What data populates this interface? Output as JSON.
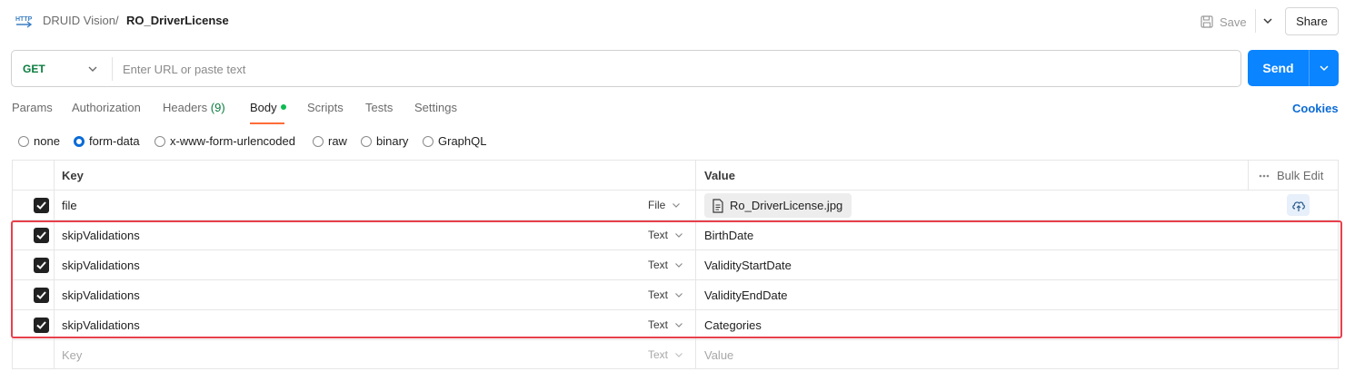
{
  "breadcrumb": {
    "collection": "DRUID Vision",
    "separator": "/",
    "request": "RO_DriverLicense"
  },
  "header": {
    "save_label": "Save",
    "share_label": "Share",
    "icons": [
      "http-icon",
      "save-icon",
      "chevron-down-icon"
    ]
  },
  "request": {
    "method": "GET",
    "url_value": "",
    "url_placeholder": "Enter URL or paste text",
    "send_label": "Send"
  },
  "tabs": [
    {
      "label": "Params"
    },
    {
      "label": "Authorization"
    },
    {
      "label": "Headers",
      "count": "(9)"
    },
    {
      "label": "Body",
      "active": true
    },
    {
      "label": "Scripts"
    },
    {
      "label": "Tests"
    },
    {
      "label": "Settings"
    }
  ],
  "cookies_label": "Cookies",
  "body_modes": [
    {
      "label": "none",
      "selected": false
    },
    {
      "label": "form-data",
      "selected": true
    },
    {
      "label": "x-www-form-urlencoded",
      "selected": false
    },
    {
      "label": "raw",
      "selected": false
    },
    {
      "label": "binary",
      "selected": false
    },
    {
      "label": "GraphQL",
      "selected": false
    }
  ],
  "table": {
    "headers": {
      "key": "Key",
      "value": "Value",
      "bulk_edit": "Bulk Edit"
    },
    "rows": [
      {
        "checked": true,
        "key": "file",
        "type": "File",
        "value": "Ro_DriverLicense.jpg",
        "is_file": true
      },
      {
        "checked": true,
        "key": "skipValidations",
        "type": "Text",
        "value": "BirthDate"
      },
      {
        "checked": true,
        "key": "skipValidations",
        "type": "Text",
        "value": "ValidityStartDate"
      },
      {
        "checked": true,
        "key": "skipValidations",
        "type": "Text",
        "value": "ValidityEndDate"
      },
      {
        "checked": true,
        "key": "skipValidations",
        "type": "Text",
        "value": "Categories"
      }
    ],
    "empty_row": {
      "key_placeholder": "Key",
      "type": "Text",
      "value_placeholder": "Value"
    }
  },
  "colors": {
    "accent": "#0a84ff",
    "method_get": "#0a7c3e",
    "tab_underline": "#ff6c37",
    "highlight_border": "#e8404c"
  }
}
